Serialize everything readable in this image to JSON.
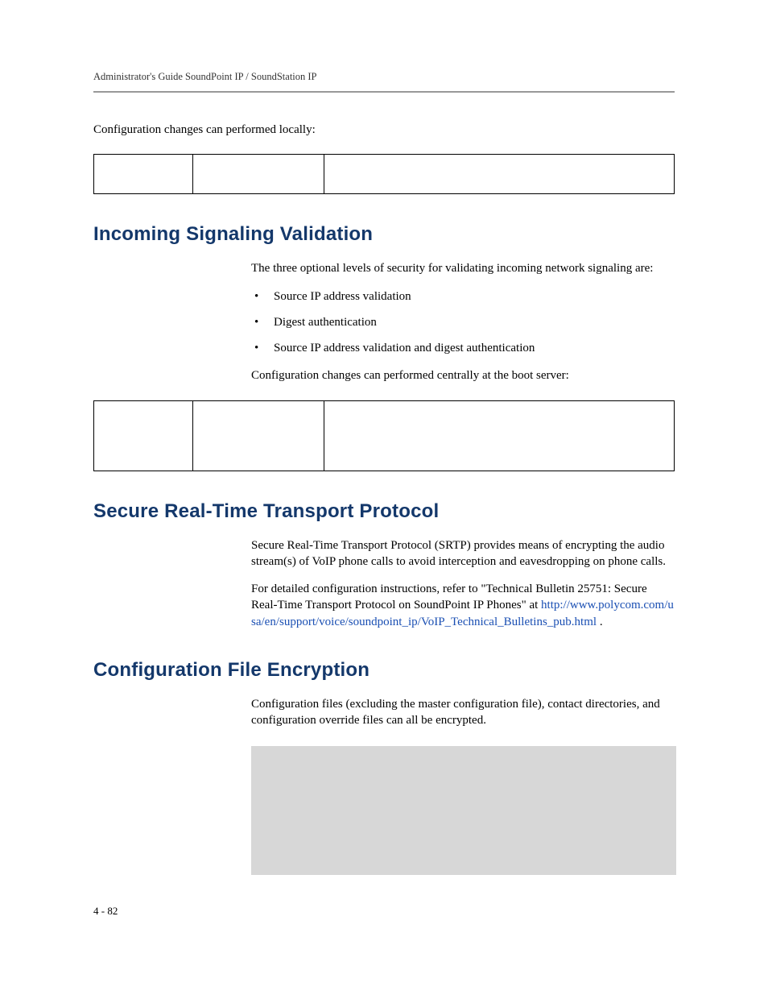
{
  "header": {
    "running": "Administrator's Guide SoundPoint IP / SoundStation IP"
  },
  "intro_line": "Configuration changes can performed locally:",
  "table1": {
    "cells": [
      "",
      "",
      ""
    ]
  },
  "section1": {
    "heading": "Incoming Signaling Validation",
    "p1": "The three optional levels of security for validating incoming network signaling are:",
    "bullets": [
      "Source IP address validation",
      "Digest authentication",
      "Source IP address validation and digest authentication"
    ],
    "p2": "Configuration changes can performed centrally at the boot server:"
  },
  "table2": {
    "cells": [
      "",
      "",
      ""
    ]
  },
  "section2": {
    "heading": "Secure Real-Time Transport Protocol",
    "p1": "Secure Real-Time Transport Protocol (SRTP) provides means of encrypting the audio stream(s) of VoIP phone calls to avoid interception and eavesdropping on phone calls.",
    "p2_pre": "For detailed configuration instructions, refer to \"Technical Bulletin 25751: Secure Real-Time Transport Protocol on SoundPoint IP Phones\" at ",
    "link": "http://www.polycom.com/usa/en/support/voice/soundpoint_ip/VoIP_Technical_Bulletins_pub.html",
    "p2_post": " ."
  },
  "section3": {
    "heading": "Configuration File Encryption",
    "p1": "Configuration files (excluding the master configuration file), contact directories, and configuration override files can all be encrypted."
  },
  "footer": {
    "page_number": "4 - 82"
  }
}
